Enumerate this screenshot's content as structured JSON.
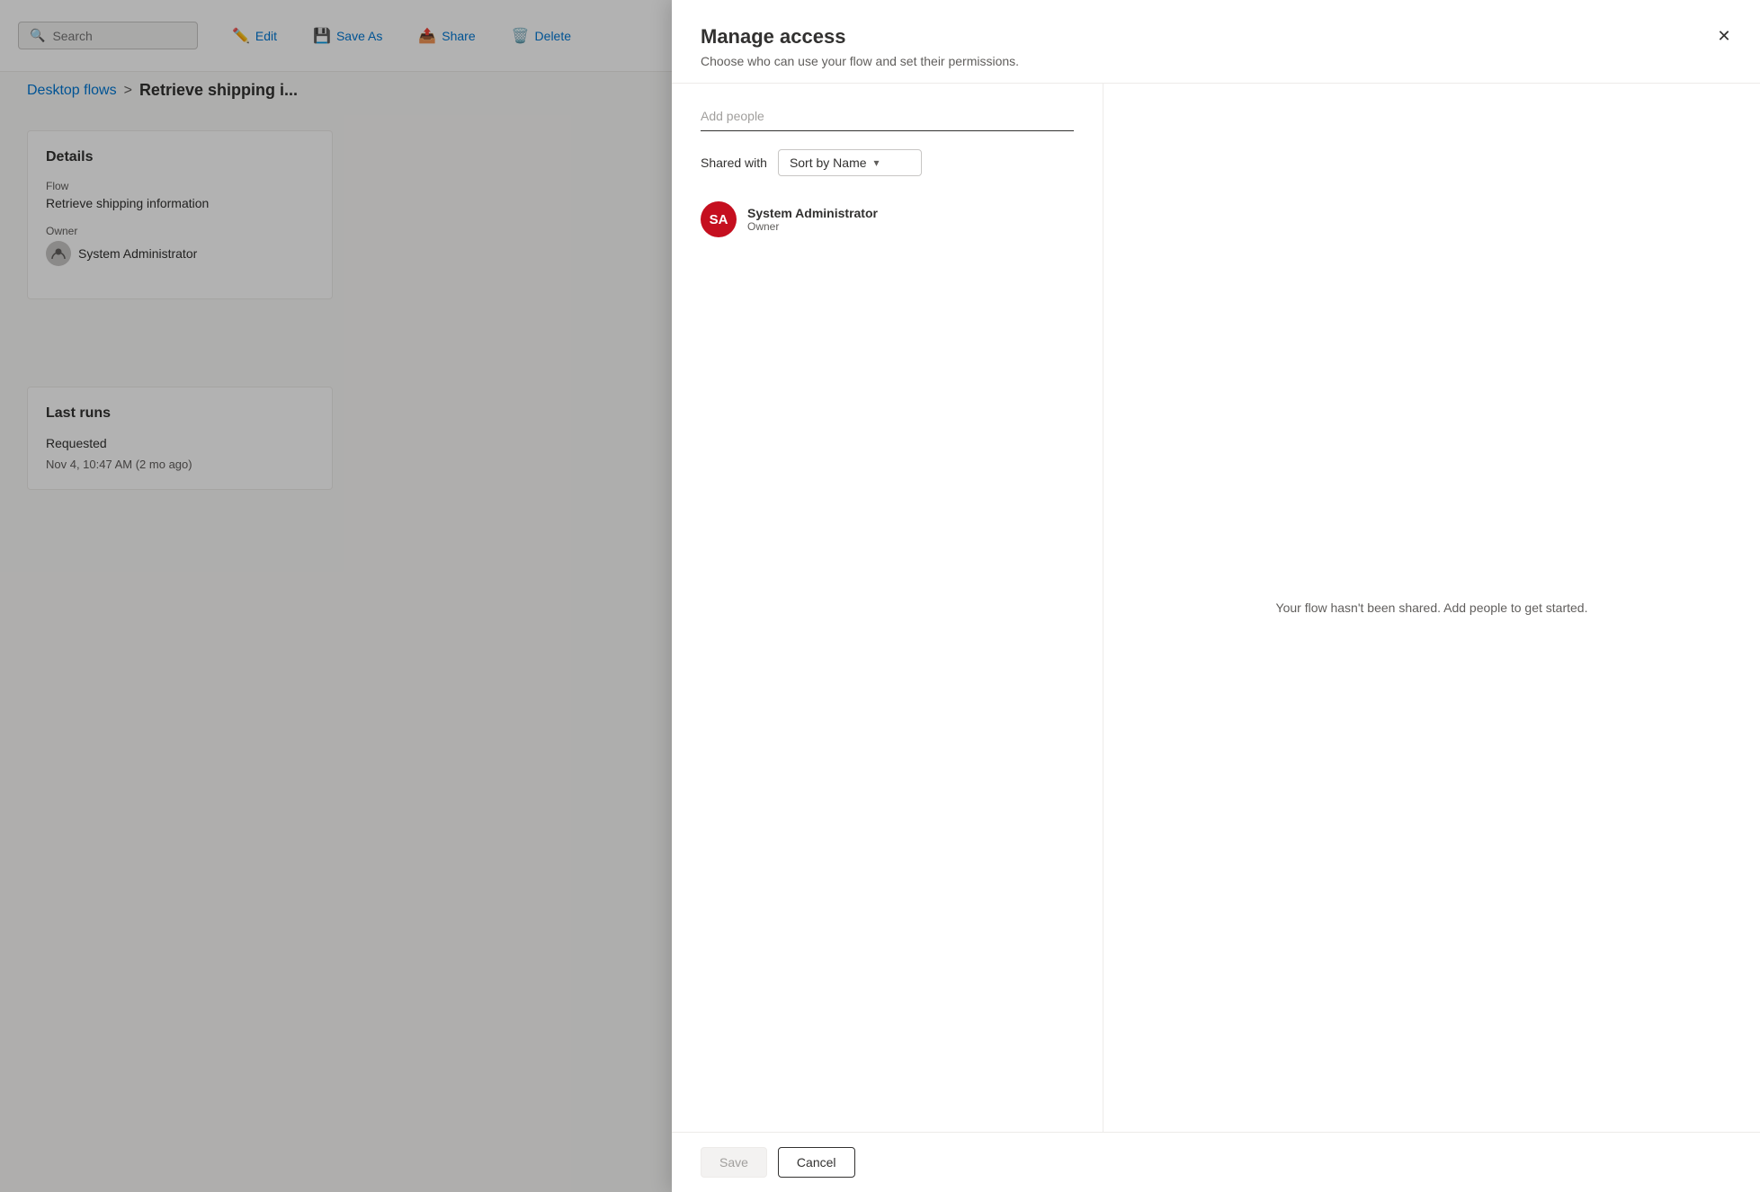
{
  "toolbar": {
    "search_placeholder": "Search",
    "edit_label": "Edit",
    "save_as_label": "Save As",
    "share_label": "Share",
    "delete_label": "Delete"
  },
  "breadcrumb": {
    "parent": "Desktop flows",
    "separator": ">",
    "current": "Retrieve shipping i..."
  },
  "details": {
    "title": "Details",
    "flow_label": "Flow",
    "flow_value": "Retrieve shipping information",
    "owner_label": "Owner",
    "owner_value": "System Administrator"
  },
  "last_runs": {
    "title": "Last runs",
    "status_label": "Requested",
    "run_date": "Nov 4, 10:47 AM (2 mo ago)"
  },
  "modal": {
    "title": "Manage access",
    "subtitle": "Choose who can use your flow and set their permissions.",
    "close_label": "✕",
    "add_people_placeholder": "Add people",
    "shared_with_label": "Shared with",
    "sort_by_label": "Sort by Name",
    "user": {
      "initials": "SA",
      "name": "System Administrator",
      "role": "Owner"
    },
    "empty_state": "Your flow hasn't been shared. Add people to get started.",
    "save_label": "Save",
    "cancel_label": "Cancel"
  }
}
